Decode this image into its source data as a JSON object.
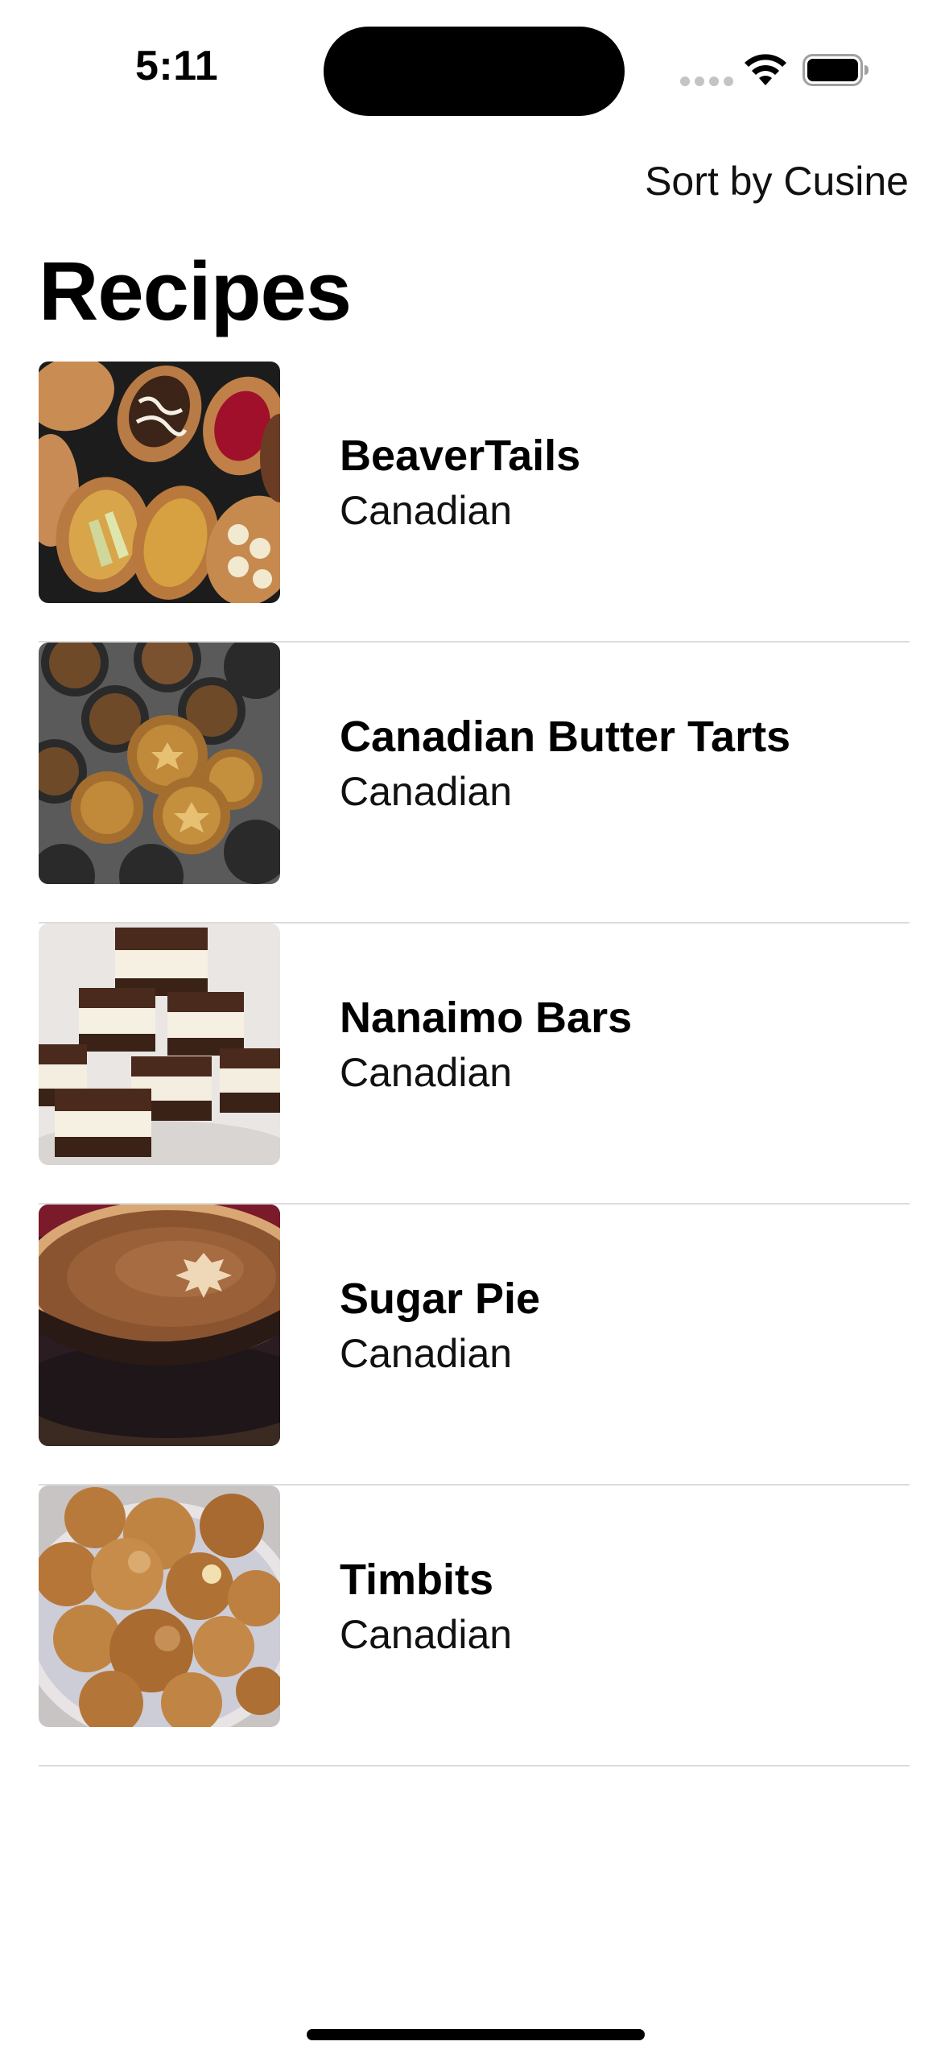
{
  "status_bar": {
    "time": "5:11"
  },
  "icons": {
    "wifi": "wifi-icon",
    "battery": "battery-icon",
    "signal": "cellular-signal-icon"
  },
  "nav": {
    "sort_label": "Sort by Cusine",
    "title": "Recipes"
  },
  "recipes": [
    {
      "name": "BeaverTails",
      "cuisine": "Canadian",
      "image": "beavertails-photo"
    },
    {
      "name": "Canadian Butter Tarts",
      "cuisine": "Canadian",
      "image": "butter-tarts-photo"
    },
    {
      "name": "Nanaimo Bars",
      "cuisine": "Canadian",
      "image": "nanaimo-bars-photo"
    },
    {
      "name": "Sugar Pie",
      "cuisine": "Canadian",
      "image": "sugar-pie-photo"
    },
    {
      "name": "Timbits",
      "cuisine": "Canadian",
      "image": "timbits-photo"
    }
  ],
  "colors": {
    "text": "#000000",
    "separator": "#dcdcdc",
    "background": "#ffffff"
  }
}
